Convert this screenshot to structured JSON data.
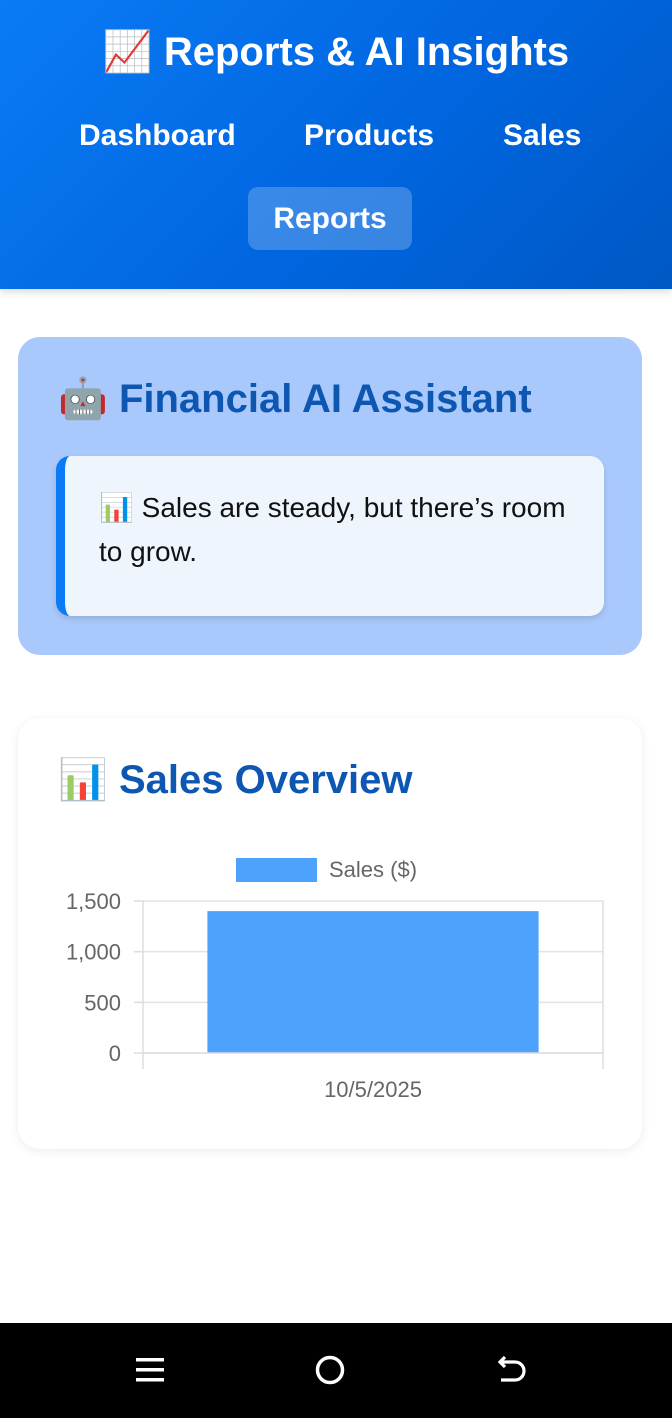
{
  "header": {
    "title_icon": "📈",
    "title": "Reports & AI Insights",
    "nav": {
      "dashboard": "Dashboard",
      "products": "Products",
      "sales": "Sales",
      "reports": "Reports"
    },
    "active_nav": "Reports",
    "background_color": "#0a7bf5"
  },
  "ai_assistant": {
    "icon": "🤖",
    "title": "Financial AI Assistant",
    "message_icon": "📊",
    "message": "Sales are steady, but there’s room to grow.",
    "background_color": "#a9c8fb",
    "title_color": "#0d57b3"
  },
  "sales_overview": {
    "icon": "📊",
    "title": "Sales Overview"
  },
  "chart_data": {
    "type": "bar",
    "categories": [
      "10/5/2025"
    ],
    "series": [
      {
        "name": "Sales ($)",
        "values": [
          1400
        ],
        "color": "#4da3fc"
      }
    ],
    "ylim": [
      0,
      1500
    ],
    "yticks": [
      0,
      500,
      1000,
      1500
    ],
    "ytick_labels": [
      "0",
      "500",
      "1,000",
      "1,500"
    ],
    "legend_position": "top",
    "grid": true
  },
  "system_nav": {
    "recents_icon": "menu-icon",
    "home_icon": "home-circle-icon",
    "back_icon": "back-arrow-icon"
  }
}
